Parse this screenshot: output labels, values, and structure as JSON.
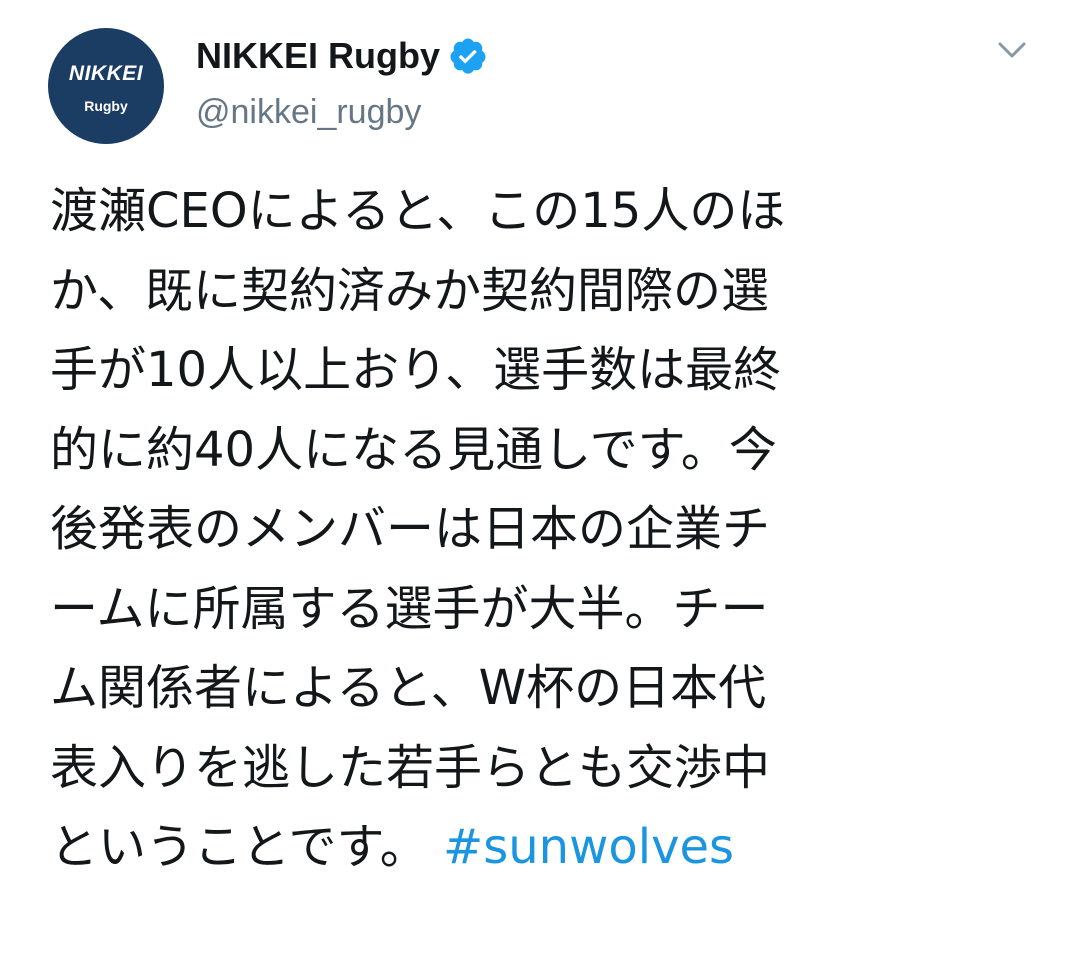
{
  "account": {
    "avatar_logo_main": "NIKKEI",
    "avatar_logo_sub": "Rugby",
    "display_name": "NIKKEI Rugby",
    "handle": "@nikkei_rugby",
    "verified": true
  },
  "colors": {
    "avatar_bg": "#1b3c63",
    "verified_badge": "#1da1f2",
    "hashtag": "#1b95e0",
    "handle": "#657786",
    "text": "#14171a"
  },
  "icons": {
    "verified": "verified-badge-icon",
    "menu": "chevron-down-icon"
  },
  "tweet": {
    "lines": [
      "渡瀬CEOによると、この15人のほ",
      "か、既に契約済みか契約間際の選",
      "手が10人以上おり、選手数は最終",
      "的に約40人になる見通しです。今",
      "後発表のメンバーは日本の企業チ",
      "ームに所属する選手が大半。チー",
      "ム関係者によると、W杯の日本代",
      "表入りを逃した若手らとも交渉中"
    ],
    "last_line_text": "ということです。",
    "hashtag": "#sunwolves"
  }
}
